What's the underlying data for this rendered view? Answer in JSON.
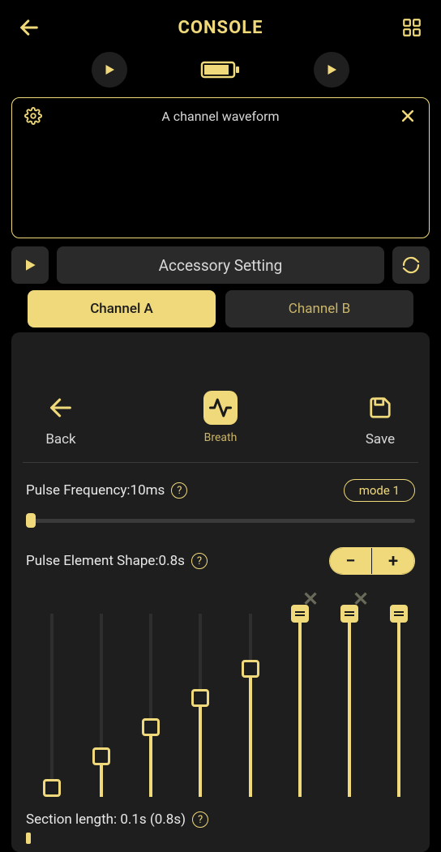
{
  "header": {
    "title": "CONSOLE"
  },
  "waveform": {
    "title": "A channel waveform"
  },
  "actions": {
    "accessory": "Accessory Setting"
  },
  "tabs": {
    "a": "Channel A",
    "b": "Channel B"
  },
  "trio": {
    "back": "Back",
    "breath": "Breath",
    "save": "Save"
  },
  "pulse_frequency": {
    "label": "Pulse Frequency:",
    "value": "10ms",
    "mode": "mode 1"
  },
  "pulse_shape": {
    "label": "Pulse Element Shape:",
    "value": "0.8s"
  },
  "shape_sliders": {
    "values_pct": [
      5,
      22,
      38,
      54,
      70,
      100,
      100,
      100
    ],
    "removable": [
      false,
      false,
      false,
      false,
      false,
      true,
      true,
      false
    ]
  },
  "section_length": {
    "label": "Section length: ",
    "value": "0.1s (0.8s)"
  },
  "help_glyph": "?",
  "x_glyph": "✕",
  "minus": "−",
  "plus": "+"
}
